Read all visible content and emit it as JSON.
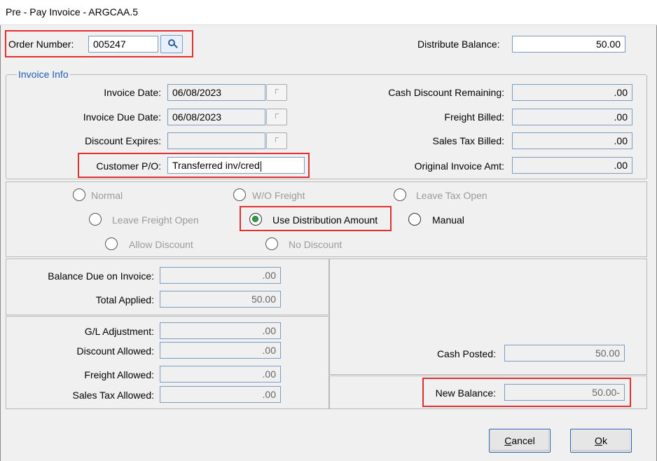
{
  "window": {
    "title": "Pre - Pay  Invoice - ARGCAA.5"
  },
  "order": {
    "label": "Order Number:",
    "value": "005247"
  },
  "distribute_balance": {
    "label": "Distribute Balance:",
    "value": "50.00"
  },
  "invoice_info": {
    "group_label": "Invoice Info",
    "invoice_date": {
      "label": "Invoice Date:",
      "value": "06/08/2023"
    },
    "invoice_due_date": {
      "label": "Invoice Due Date:",
      "value": "06/08/2023"
    },
    "discount_expires": {
      "label": "Discount Expires:",
      "value": ""
    },
    "customer_po": {
      "label": "Customer P/O:",
      "value": "Transferred inv/cred"
    },
    "cash_discount_remaining": {
      "label": "Cash Discount Remaining:",
      "value": ".00"
    },
    "freight_billed": {
      "label": "Freight Billed:",
      "value": ".00"
    },
    "sales_tax_billed": {
      "label": "Sales Tax Billed:",
      "value": ".00"
    },
    "original_invoice_amt": {
      "label": "Original Invoice Amt:",
      "value": ".00"
    }
  },
  "options": {
    "normal": "Normal",
    "wo_freight": "W/O Freight",
    "leave_tax_open": "Leave Tax Open",
    "leave_freight_open": "Leave Freight Open",
    "use_distribution_amount": "Use Distribution Amount",
    "manual": "Manual",
    "allow_discount": "Allow Discount",
    "no_discount": "No Discount",
    "selected": "use_distribution_amount"
  },
  "balance": {
    "balance_due": {
      "label": "Balance Due on Invoice:",
      "value": ".00"
    },
    "total_applied": {
      "label": "Total Applied:",
      "value": "50.00"
    }
  },
  "adjustments": {
    "gl_adjustment": {
      "label": "G/L Adjustment:",
      "value": ".00"
    },
    "discount_allowed": {
      "label": "Discount Allowed:",
      "value": ".00"
    },
    "freight_allowed": {
      "label": "Freight Allowed:",
      "value": ".00"
    },
    "sales_tax_allowed": {
      "label": "Sales Tax Allowed:",
      "value": ".00"
    }
  },
  "cash_posted": {
    "label": "Cash Posted:",
    "value": "50.00"
  },
  "new_balance": {
    "label": "New Balance:",
    "value": "50.00-"
  },
  "buttons": {
    "cancel_first": "C",
    "cancel_rest": "ancel",
    "ok_first": "O",
    "ok_rest": "k"
  },
  "colors": {
    "highlight": "#e03030",
    "group_label": "#1a5fb4",
    "field_border": "#7a9cc6",
    "radio_checked": "#2e9b46"
  }
}
